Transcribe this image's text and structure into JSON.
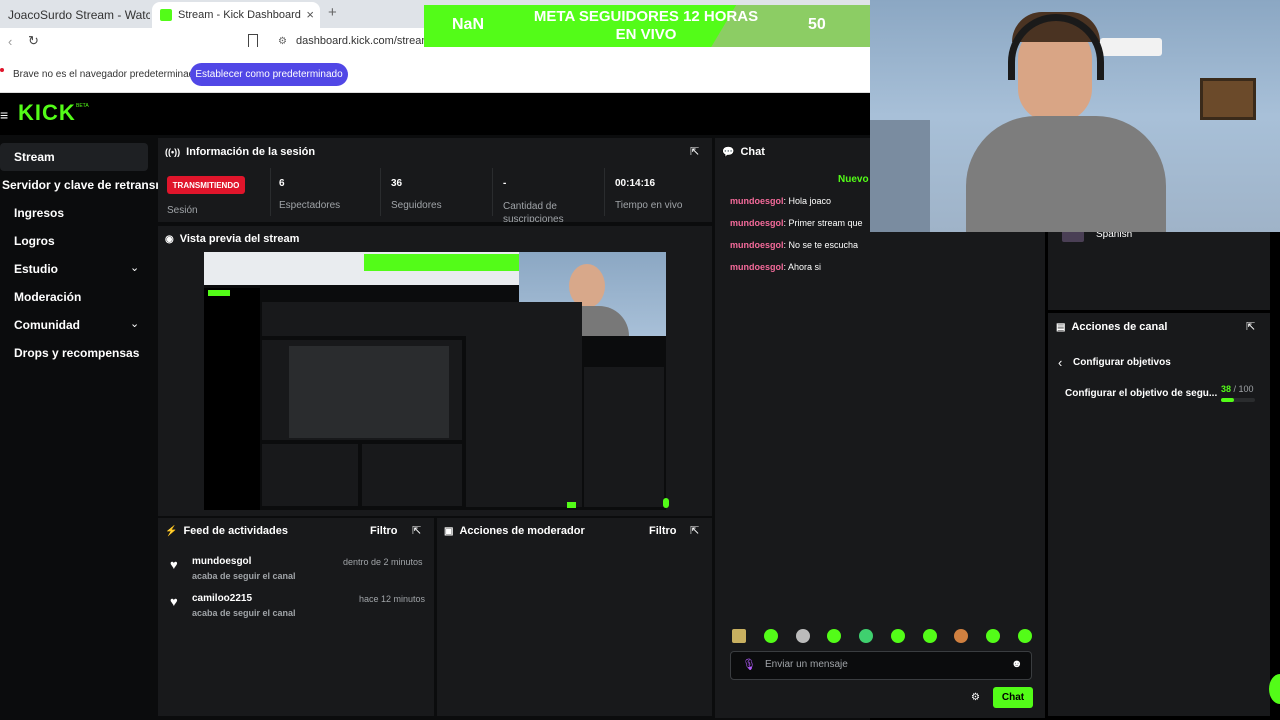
{
  "browser": {
    "tab1_label": "JoacoSurdo Stream - Watch Live on",
    "tab2_label": "Stream - Kick Dashboard",
    "url": "dashboard.kick.com/stream",
    "info_text": "Brave no es el navegador predeterminado",
    "info_button": "Establecer como predeterminado"
  },
  "overlay": {
    "left": "NaN",
    "title_line1": "META SEGUIDORES 12 HORAS",
    "title_line2": "EN VIVO",
    "right": "50",
    "progress_fraction": 0.7
  },
  "logo": "KICK",
  "logo_badge": "BETA",
  "sidebar": {
    "items": [
      {
        "label": "Stream"
      },
      {
        "label": "Servidor y clave de retransm"
      },
      {
        "label": "Ingresos"
      },
      {
        "label": "Logros"
      },
      {
        "label": "Estudio"
      },
      {
        "label": "Moderación"
      },
      {
        "label": "Comunidad"
      },
      {
        "label": "Drops y recompensas"
      }
    ]
  },
  "session": {
    "title": "Información de la sesión",
    "status": "TRANSMITIENDO",
    "status_sub": "Sesión",
    "stats": [
      {
        "value": "6",
        "label": "Espectadores"
      },
      {
        "value": "36",
        "label": "Seguidores"
      },
      {
        "value": "-",
        "label": "Cantidad de suscripciones"
      },
      {
        "value": "00:14:16",
        "label": "Tiempo en vivo"
      }
    ]
  },
  "preview": {
    "title": "Vista previa del stream"
  },
  "activity": {
    "title": "Feed de actividades",
    "filter": "Filtro",
    "items": [
      {
        "user": "mundoesgol",
        "action": "acaba de seguir el canal",
        "time": "dentro de 2 minutos"
      },
      {
        "user": "camiloo2215",
        "action": "acaba de seguir el canal",
        "time": "hace 12 minutos"
      }
    ]
  },
  "modactions": {
    "title": "Acciones de moderador",
    "filter": "Filtro"
  },
  "chat": {
    "title": "Chat",
    "new_label": "Nuevo",
    "messages": [
      {
        "user": "mundoesgol",
        "text": "Hola joaco"
      },
      {
        "user": "mundoesgol",
        "text": "Primer stream que"
      },
      {
        "user": "mundoesgol",
        "text": "No se te escucha"
      },
      {
        "user": "mundoesgol",
        "text": "Ahora si"
      }
    ],
    "placeholder": "Enviar un mensaje",
    "send": "Chat"
  },
  "stream_info": {
    "language": "Spanish"
  },
  "channel_actions": {
    "title": "Acciones de canal",
    "back_label": "Configurar objetivos",
    "goal_label": "Configurar el objetivo de segu...",
    "goal_current": "38",
    "goal_total": "/ 100",
    "goal_fraction": 0.38
  },
  "colors": {
    "accent": "#53fc18",
    "live_red": "#e0152b",
    "brave_blue": "#5147e6"
  }
}
